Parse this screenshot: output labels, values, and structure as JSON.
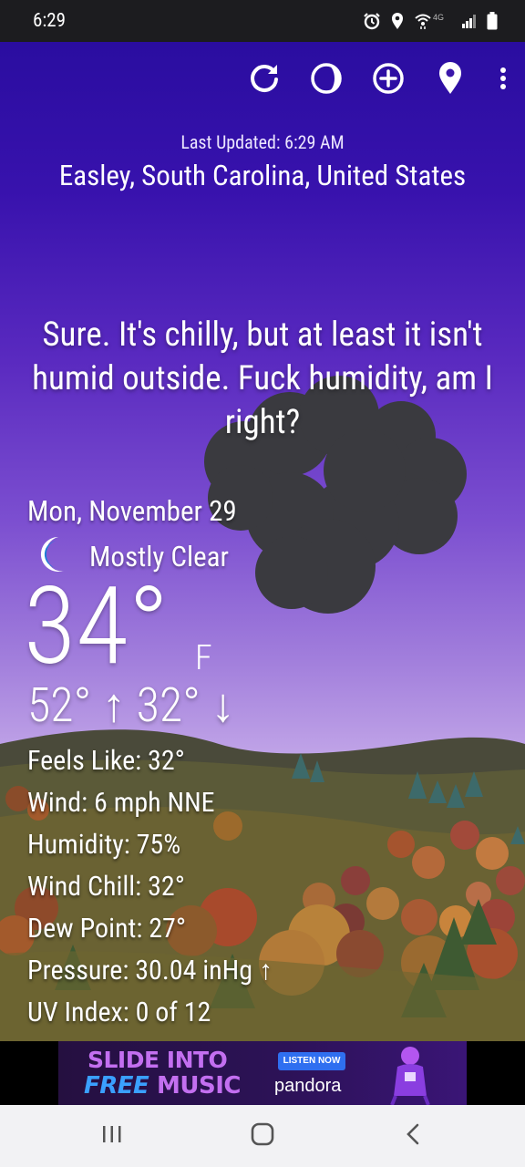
{
  "status_bar": {
    "time": "6:29",
    "icons": [
      "alarm-icon",
      "location-icon",
      "wifi-4g-icon",
      "signal-icon",
      "battery-icon"
    ],
    "network_label": "4G"
  },
  "toolbar": {
    "actions": [
      "refresh-icon",
      "moon-phase-icon",
      "add-location-icon",
      "location-pin-icon",
      "overflow-menu-icon"
    ]
  },
  "header": {
    "last_updated": "Last Updated: 6:29 AM",
    "location": "Easley, South Carolina, United States"
  },
  "quip": "Sure. It's chilly, but at least it isn't humid outside. Fuck humidity, am I right?",
  "current": {
    "date": "Mon, November 29",
    "condition_icon": "crescent-moon-icon",
    "condition": "Mostly Clear",
    "temperature": "34°",
    "unit": "F",
    "high_low": "52° ↑ 32° ↓"
  },
  "details": [
    "Feels Like:  32°",
    "Wind:  6 mph NNE",
    "Humidity:  75%",
    "Wind Chill:  32°",
    "Dew Point:  27°",
    "Pressure:  30.04 inHg ↑",
    "UV Index:  0 of 12"
  ],
  "ad": {
    "headline_1": "SLIDE INTO",
    "headline_free": "FREE",
    "headline_music": "MUSIC",
    "cta": "LISTEN NOW",
    "brand": "pandora"
  },
  "nav_bar": [
    "recents-icon",
    "home-icon",
    "back-icon"
  ],
  "colors": {
    "sky_top": "#2a0da0",
    "sky_bottom": "#d0b8ee",
    "ad_accent": "#c36ff0",
    "cta_blue": "#2f6ff0"
  }
}
